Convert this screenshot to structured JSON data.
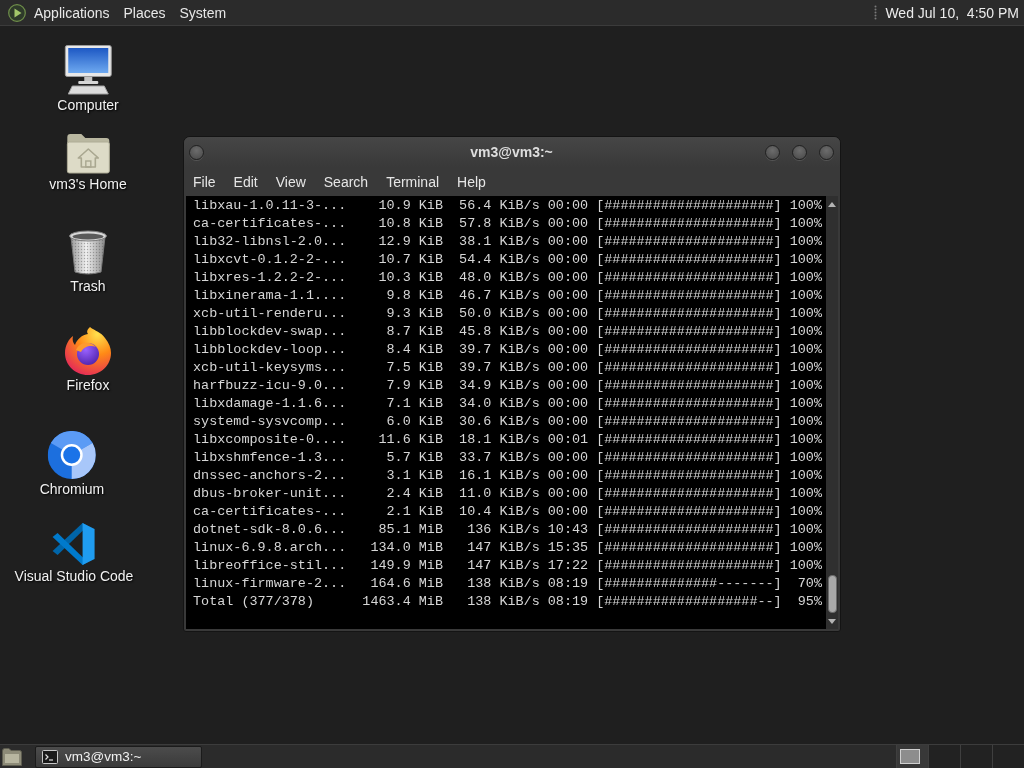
{
  "top_panel": {
    "menus": [
      "Applications",
      "Places",
      "System"
    ],
    "clock": "Wed Jul 10,  4:50 PM"
  },
  "desktop_icons": [
    {
      "label": "Computer",
      "kind": "computer"
    },
    {
      "label": "vm3's Home",
      "kind": "home"
    },
    {
      "label": "Trash",
      "kind": "trash"
    },
    {
      "label": "Firefox",
      "kind": "firefox"
    },
    {
      "label": "Chromium",
      "kind": "chromium"
    },
    {
      "label": "Visual Studio Code",
      "kind": "vscode"
    }
  ],
  "terminal_window": {
    "title": "vm3@vm3:~",
    "menu": [
      "File",
      "Edit",
      "View",
      "Search",
      "Terminal",
      "Help"
    ],
    "lines": [
      "libxau-1.0.11-3-...    10.9 KiB  56.4 KiB/s 00:00 [#####################] 100%",
      "ca-certificates-...    10.8 KiB  57.8 KiB/s 00:00 [#####################] 100%",
      "lib32-libnsl-2.0...    12.9 KiB  38.1 KiB/s 00:00 [#####################] 100%",
      "libxcvt-0.1.2-2-...    10.7 KiB  54.4 KiB/s 00:00 [#####################] 100%",
      "libxres-1.2.2-2-...    10.3 KiB  48.0 KiB/s 00:00 [#####################] 100%",
      "libxinerama-1.1....     9.8 KiB  46.7 KiB/s 00:00 [#####################] 100%",
      "xcb-util-renderu...     9.3 KiB  50.0 KiB/s 00:00 [#####################] 100%",
      "libblockdev-swap...     8.7 KiB  45.8 KiB/s 00:00 [#####################] 100%",
      "libblockdev-loop...     8.4 KiB  39.7 KiB/s 00:00 [#####################] 100%",
      "xcb-util-keysyms...     7.5 KiB  39.7 KiB/s 00:00 [#####################] 100%",
      "harfbuzz-icu-9.0...     7.9 KiB  34.9 KiB/s 00:00 [#####################] 100%",
      "libxdamage-1.1.6...     7.1 KiB  34.0 KiB/s 00:00 [#####################] 100%",
      "systemd-sysvcomp...     6.0 KiB  30.6 KiB/s 00:00 [#####################] 100%",
      "libxcomposite-0....    11.6 KiB  18.1 KiB/s 00:01 [#####################] 100%",
      "libxshmfence-1.3...     5.7 KiB  33.7 KiB/s 00:00 [#####################] 100%",
      "dnssec-anchors-2...     3.1 KiB  16.1 KiB/s 00:00 [#####################] 100%",
      "dbus-broker-unit...     2.4 KiB  11.0 KiB/s 00:00 [#####################] 100%",
      "ca-certificates-...     2.1 KiB  10.4 KiB/s 00:00 [#####################] 100%",
      "dotnet-sdk-8.0.6...    85.1 MiB   136 KiB/s 10:43 [#####################] 100%",
      "linux-6.9.8.arch...   134.0 MiB   147 KiB/s 15:35 [#####################] 100%",
      "libreoffice-stil...   149.9 MiB   147 KiB/s 17:22 [#####################] 100%",
      "linux-firmware-2...   164.6 MiB   138 KiB/s 08:19 [##############-------]  70%",
      "Total (377/378)      1463.4 MiB   138 KiB/s 08:19 [###################--]  95%"
    ]
  },
  "bottom_panel": {
    "tasks": [
      {
        "label": "vm3@vm3:~",
        "selected": true
      }
    ],
    "workspaces": [
      {
        "selected": true
      },
      {
        "selected": false
      },
      {
        "selected": false
      },
      {
        "selected": false
      }
    ]
  }
}
